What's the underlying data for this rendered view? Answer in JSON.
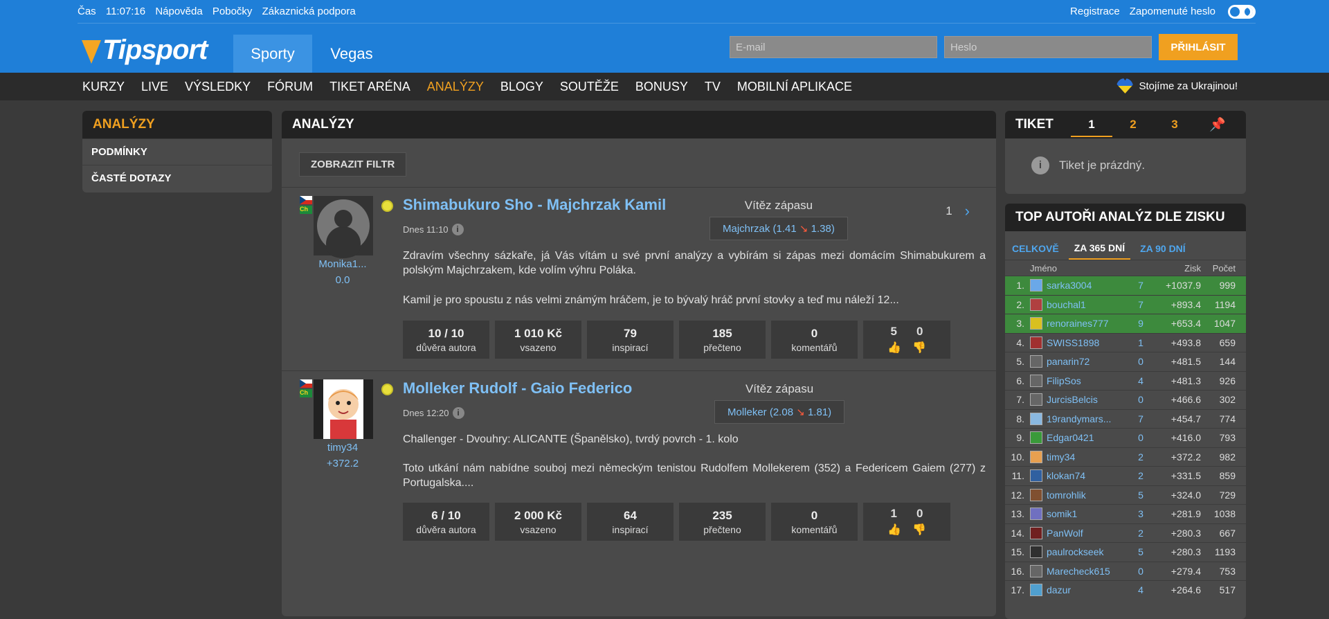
{
  "util": {
    "time_label": "Čas",
    "time": "11:07:16",
    "help": "Nápověda",
    "branches": "Pobočky",
    "support": "Zákaznická podpora",
    "register": "Registrace",
    "forgot": "Zapomenuté heslo"
  },
  "brand": {
    "name": "Tipsport"
  },
  "tabs": [
    "Sporty",
    "Vegas"
  ],
  "login": {
    "email_placeholder": "E-mail",
    "password_placeholder": "Heslo",
    "submit": "PŘIHLÁSIT"
  },
  "nav": [
    "KURZY",
    "LIVE",
    "VÝSLEDKY",
    "FÓRUM",
    "TIKET ARÉNA",
    "ANALÝZY",
    "BLOGY",
    "SOUTĚŽE",
    "BONUSY",
    "TV",
    "MOBILNÍ APLIKACE"
  ],
  "nav_active": "ANALÝZY",
  "ukraine": "Stojíme za Ukrajinou!",
  "left": {
    "title": "ANALÝZY",
    "items": [
      "PODMÍNKY",
      "ČASTÉ DOTAZY"
    ]
  },
  "main": {
    "title": "ANALÝZY",
    "filter": "ZOBRAZIT FILTR",
    "page": "1"
  },
  "posts": [
    {
      "user": "Monika1...",
      "user_profit": "0.0",
      "flag2": "Ch",
      "title": "Shimabukuro Sho - Majchrzak Kamil",
      "date": "Dnes 11:10",
      "bet_label": "Vítěz zápasu",
      "bet_text": "Majchrzak (1.41",
      "bet_arrow": "↘",
      "bet_new": "1.38)",
      "text1": "Zdravím všechny sázkaře, já Vás vítám u své první analýzy a vybírám si zápas mezi domácím Shimabukurem a polským Majchrzakem, kde volím výhru Poláka.",
      "text2": "Kamil je pro spoustu z nás velmi známým hráčem, je to bývalý hráč první stovky a teď mu náleží 12...",
      "stats": [
        {
          "v": "10 / 10",
          "l": "důvěra autora"
        },
        {
          "v": "1 010 Kč",
          "l": "vsazeno"
        },
        {
          "v": "79",
          "l": "inspirací"
        },
        {
          "v": "185",
          "l": "přečteno"
        },
        {
          "v": "0",
          "l": "komentářů"
        }
      ],
      "likes": "5",
      "dislikes": "0"
    },
    {
      "user": "timy34",
      "user_profit": "+372.2",
      "flag2": "Ch",
      "title": "Molleker Rudolf - Gaio Federico",
      "date": "Dnes 12:20",
      "bet_label": "Vítěz zápasu",
      "bet_text": "Molleker (2.08",
      "bet_arrow": "↘",
      "bet_new": "1.81)",
      "text1": "Challenger - Dvouhry: ALICANTE (Španělsko), tvrdý povrch - 1. kolo",
      "text2": "Toto utkání nám nabídne souboj mezi německým tenistou Rudolfem Mollekerem (352) a Federicem Gaiem (277) z Portugalska....",
      "stats": [
        {
          "v": "6 / 10",
          "l": "důvěra autora"
        },
        {
          "v": "2 000 Kč",
          "l": "vsazeno"
        },
        {
          "v": "64",
          "l": "inspirací"
        },
        {
          "v": "235",
          "l": "přečteno"
        },
        {
          "v": "0",
          "l": "komentářů"
        }
      ],
      "likes": "1",
      "dislikes": "0"
    }
  ],
  "tiket": {
    "title": "TIKET",
    "tabs": [
      "1",
      "2",
      "3"
    ],
    "empty": "Tiket je prázdný."
  },
  "top": {
    "title": "TOP AUTOŘI ANALÝZ DLE ZISKU",
    "tabs": [
      "CELKOVĚ",
      "ZA 365 DNÍ",
      "ZA 90 DNÍ"
    ],
    "headers": {
      "name": "Jméno",
      "profit": "Zisk",
      "count": "Počet"
    },
    "rows": [
      {
        "rank": "1.",
        "name": "sarka3004",
        "n": "7",
        "profit": "+1037.9",
        "count": "999",
        "green": true,
        "color": "#6aa8e8"
      },
      {
        "rank": "2.",
        "name": "bouchal1",
        "n": "7",
        "profit": "+893.4",
        "count": "1194",
        "green": true,
        "color": "#b04040"
      },
      {
        "rank": "3.",
        "name": "renoraines777",
        "n": "9",
        "profit": "+653.4",
        "count": "1047",
        "green": true,
        "color": "#d8c020"
      },
      {
        "rank": "4.",
        "name": "SWISS1898",
        "n": "1",
        "profit": "+493.8",
        "count": "659",
        "green": false,
        "color": "#a03030"
      },
      {
        "rank": "5.",
        "name": "panarin72",
        "n": "0",
        "profit": "+481.5",
        "count": "144",
        "green": false,
        "color": "#666"
      },
      {
        "rank": "6.",
        "name": "FilipSos",
        "n": "4",
        "profit": "+481.3",
        "count": "926",
        "green": false,
        "color": "#666"
      },
      {
        "rank": "7.",
        "name": "JurcisBelcis",
        "n": "0",
        "profit": "+466.6",
        "count": "302",
        "green": false,
        "color": "#666"
      },
      {
        "rank": "8.",
        "name": "19randymars...",
        "n": "7",
        "profit": "+454.7",
        "count": "774",
        "green": false,
        "color": "#8ab8e0"
      },
      {
        "rank": "9.",
        "name": "Edgar0421",
        "n": "0",
        "profit": "+416.0",
        "count": "793",
        "green": false,
        "color": "#3a9a3a"
      },
      {
        "rank": "10.",
        "name": "timy34",
        "n": "2",
        "profit": "+372.2",
        "count": "982",
        "green": false,
        "color": "#e8a050"
      },
      {
        "rank": "11.",
        "name": "klokan74",
        "n": "2",
        "profit": "+331.5",
        "count": "859",
        "green": false,
        "color": "#3060a0"
      },
      {
        "rank": "12.",
        "name": "tomrohlik",
        "n": "5",
        "profit": "+324.0",
        "count": "729",
        "green": false,
        "color": "#805030"
      },
      {
        "rank": "13.",
        "name": "somik1",
        "n": "3",
        "profit": "+281.9",
        "count": "1038",
        "green": false,
        "color": "#7070c0"
      },
      {
        "rank": "14.",
        "name": "PanWolf",
        "n": "2",
        "profit": "+280.3",
        "count": "667",
        "green": false,
        "color": "#702020"
      },
      {
        "rank": "15.",
        "name": "paulrockseek",
        "n": "5",
        "profit": "+280.3",
        "count": "1193",
        "green": false,
        "color": "#303030"
      },
      {
        "rank": "16.",
        "name": "Marecheck615",
        "n": "0",
        "profit": "+279.4",
        "count": "753",
        "green": false,
        "color": "#666"
      },
      {
        "rank": "17.",
        "name": "dazur",
        "n": "4",
        "profit": "+264.6",
        "count": "517",
        "green": false,
        "color": "#50a0d0"
      }
    ]
  }
}
